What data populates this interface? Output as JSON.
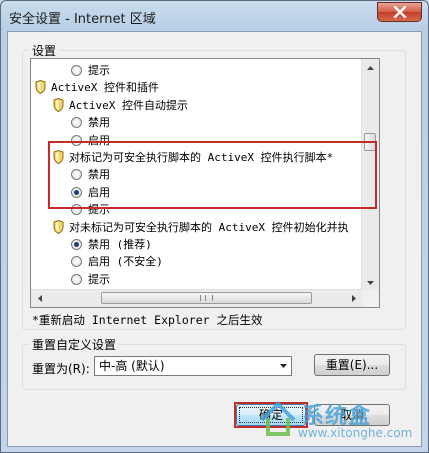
{
  "window": {
    "title": "安全设置 - Internet 区域",
    "close_icon": "close-icon"
  },
  "settings": {
    "legend": "设置",
    "rows": [
      {
        "kind": "radio",
        "label": "提示",
        "checked": false
      },
      {
        "kind": "category",
        "label": "ActiveX 控件和插件"
      },
      {
        "kind": "subcategory",
        "label": "ActiveX 控件自动提示"
      },
      {
        "kind": "radio",
        "label": "禁用",
        "checked": false
      },
      {
        "kind": "radio",
        "label": "启用",
        "checked": false
      },
      {
        "kind": "subcategory",
        "label": "对标记为可安全执行脚本的 ActiveX 控件执行脚本*"
      },
      {
        "kind": "radio",
        "label": "禁用",
        "checked": false
      },
      {
        "kind": "radio",
        "label": "启用",
        "checked": true
      },
      {
        "kind": "radio",
        "label": "提示",
        "checked": false
      },
      {
        "kind": "subcategory",
        "label": "对未标记为可安全执行脚本的 ActiveX 控件初始化并执"
      },
      {
        "kind": "radio",
        "label": "禁用 (推荐)",
        "checked": true
      },
      {
        "kind": "radio",
        "label": "启用 (不安全)",
        "checked": false
      },
      {
        "kind": "radio",
        "label": "提示",
        "checked": false
      },
      {
        "kind": "subcategory",
        "label": "二进制和脚本行为"
      }
    ],
    "note": "*重新启动 Internet Explorer 之后生效"
  },
  "reset": {
    "legend": "重置自定义设置",
    "label": "重置为(R):",
    "selected": "中-高 (默认)",
    "button": "重置(E)..."
  },
  "buttons": {
    "ok": "确定",
    "cancel": "取消"
  },
  "watermark": {
    "title": "系统盒",
    "url": "www.xitonghe.com"
  },
  "colors": {
    "highlight": "#c42b2b",
    "accent": "#3c7fb1"
  }
}
